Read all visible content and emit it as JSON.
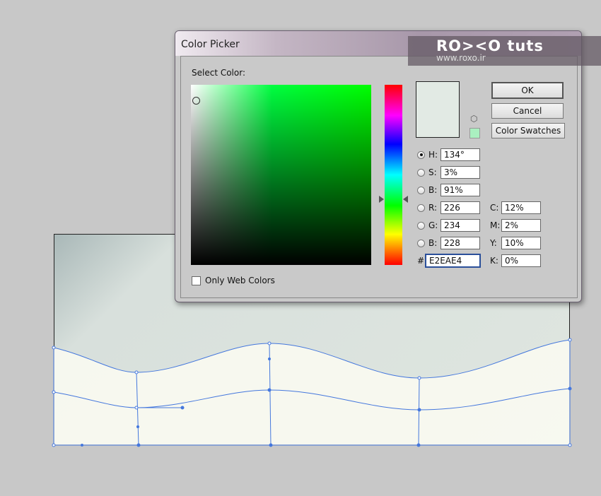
{
  "dialog": {
    "title": "Color Picker",
    "select_label": "Select Color:",
    "ok": "OK",
    "cancel": "Cancel",
    "swatches": "Color Swatches",
    "web_colors": "Only Web Colors",
    "hash": "#"
  },
  "fields": {
    "hsb": [
      {
        "label": "H:",
        "value": "134°",
        "selected": true
      },
      {
        "label": "S:",
        "value": "3%"
      },
      {
        "label": "B:",
        "value": "91%"
      }
    ],
    "rgb": [
      {
        "label": "R:",
        "value": "226"
      },
      {
        "label": "G:",
        "value": "234"
      },
      {
        "label": "B:",
        "value": "228"
      }
    ],
    "hex": "E2EAE4",
    "cmyk": [
      {
        "label": "C:",
        "value": "12%"
      },
      {
        "label": "M:",
        "value": "2%"
      },
      {
        "label": "Y:",
        "value": "10%"
      },
      {
        "label": "K:",
        "value": "0%"
      }
    ]
  },
  "colors": {
    "current": "#e2eae4",
    "gamut_warning": "#aaf0c0",
    "accent": "#3366dd"
  },
  "watermark": {
    "brand": "RO><O tuts",
    "url": "www.roxo.ir"
  }
}
